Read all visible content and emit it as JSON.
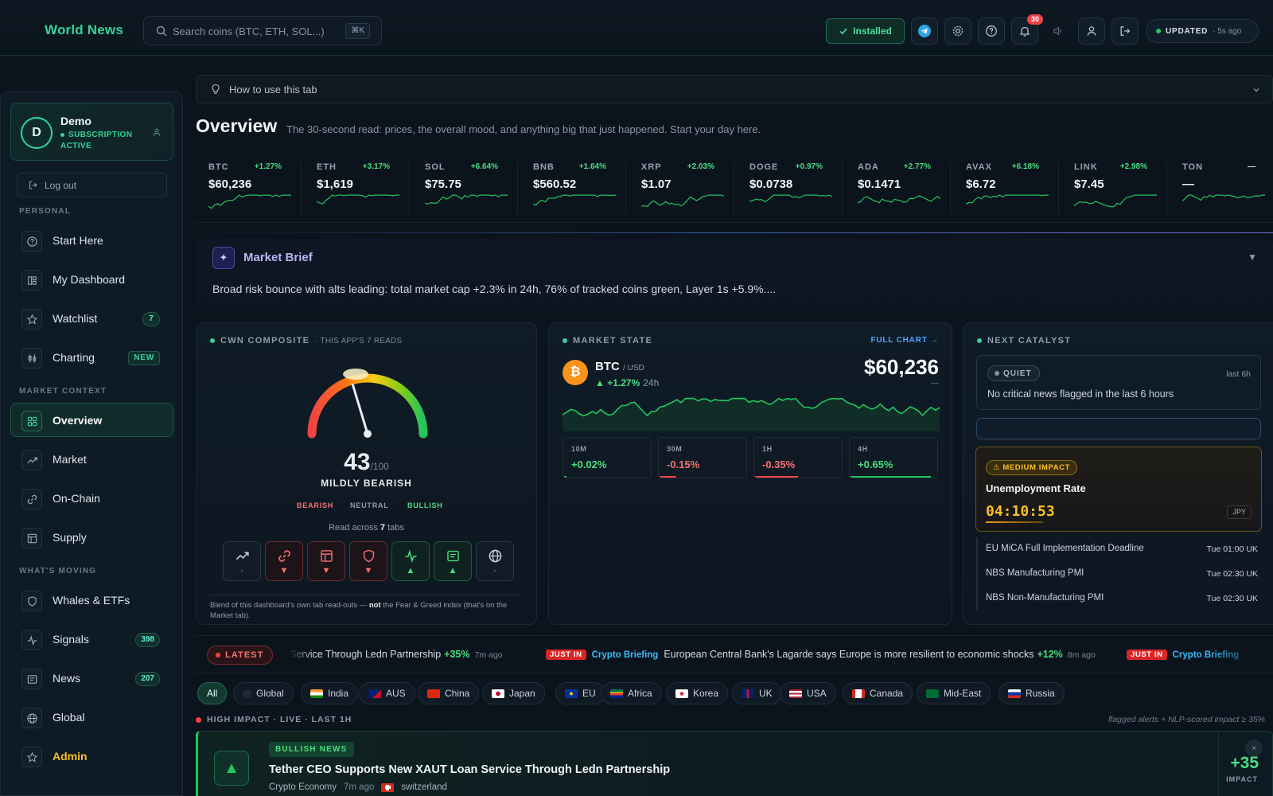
{
  "app": {
    "brand": "World News"
  },
  "search": {
    "placeholder": "Search coins (BTC, ETH, SOL...)",
    "shortcut": "⌘K"
  },
  "toolbar": {
    "installed_label": "Installed",
    "notifications_count": "30",
    "updated_label": "UPDATED",
    "updated_ago": "· 5s ago",
    "icons": [
      "telegram-icon",
      "settings-icon",
      "help-icon",
      "bell-icon",
      "sound-icon",
      "user-icon",
      "logout-icon"
    ]
  },
  "user": {
    "initial": "D",
    "name": "Demo",
    "status": "SUBSCRIPTION ACTIVE"
  },
  "sidebar": {
    "logout_label": "Log out",
    "sections": [
      {
        "label": "PERSONAL",
        "items": [
          {
            "label": "Start Here",
            "icon": "help-circle-icon",
            "badge": ""
          },
          {
            "label": "My Dashboard",
            "icon": "dashboard-icon",
            "badge": ""
          },
          {
            "label": "Watchlist",
            "icon": "star-icon",
            "badge": "7"
          },
          {
            "label": "Charting",
            "icon": "candles-icon",
            "badge": "NEW"
          }
        ]
      },
      {
        "label": "MARKET CONTEXT",
        "items": [
          {
            "label": "Overview",
            "icon": "grid-icon",
            "badge": "",
            "active": true
          },
          {
            "label": "Market",
            "icon": "trend-icon",
            "badge": ""
          },
          {
            "label": "On-Chain",
            "icon": "link-icon",
            "badge": ""
          },
          {
            "label": "Supply",
            "icon": "layout-icon",
            "badge": ""
          }
        ]
      },
      {
        "label": "WHAT'S MOVING",
        "items": [
          {
            "label": "Whales & ETFs",
            "icon": "shield-icon",
            "badge": ""
          },
          {
            "label": "Signals",
            "icon": "pulse-icon",
            "badge": "398"
          },
          {
            "label": "News",
            "icon": "news-icon",
            "badge": "207"
          },
          {
            "label": "Global",
            "icon": "globe-icon",
            "badge": ""
          },
          {
            "label": "Admin",
            "icon": "star-icon",
            "badge": ""
          }
        ]
      }
    ]
  },
  "howto": {
    "label": "How to use this tab"
  },
  "overview": {
    "title": "Overview",
    "subtitle": "The 30-second read: prices, the overall mood, and anything big that just happened. Start your day here."
  },
  "tickers": [
    {
      "sym": "BTC",
      "price": "$60,236",
      "chg": "+1.27%"
    },
    {
      "sym": "ETH",
      "price": "$1,619",
      "chg": "+3.17%"
    },
    {
      "sym": "SOL",
      "price": "$75.75",
      "chg": "+6.64%"
    },
    {
      "sym": "BNB",
      "price": "$560.52",
      "chg": "+1.64%"
    },
    {
      "sym": "XRP",
      "price": "$1.07",
      "chg": "+2.03%"
    },
    {
      "sym": "DOGE",
      "price": "$0.0738",
      "chg": "+0.97%"
    },
    {
      "sym": "ADA",
      "price": "$0.1471",
      "chg": "+2.77%"
    },
    {
      "sym": "AVAX",
      "price": "$6.72",
      "chg": "+6.18%"
    },
    {
      "sym": "LINK",
      "price": "$7.45",
      "chg": "+2.98%"
    },
    {
      "sym": "TON",
      "price": "—",
      "chg": "—"
    }
  ],
  "brief": {
    "title": "Market Brief",
    "text": "Broad risk bounce with alts leading: total market cap +2.3% in 24h, 76% of tracked coins green, Layer 1s +5.9%...."
  },
  "composite": {
    "heading": "CWN COMPOSITE",
    "subheading": "· THIS APP'S 7 READS",
    "score": 43,
    "score_text": "43",
    "score_max": "/100",
    "label": "MILDLY BEARISH",
    "scale": [
      "BEARISH",
      "NEUTRAL",
      "BULLISH"
    ],
    "read_prefix": "Read across",
    "read_count": "7",
    "read_suffix": "tabs",
    "tabs": [
      {
        "icon": "trend-icon",
        "state": "neutral",
        "mark": "·"
      },
      {
        "icon": "link-icon",
        "state": "bearish",
        "mark": "▼"
      },
      {
        "icon": "layout-icon",
        "state": "bearish",
        "mark": "▼"
      },
      {
        "icon": "shield-icon",
        "state": "bearish",
        "mark": "▼"
      },
      {
        "icon": "pulse-icon",
        "state": "bullish",
        "mark": "▲"
      },
      {
        "icon": "news-icon",
        "state": "bullish",
        "mark": "▲"
      },
      {
        "icon": "globe-icon",
        "state": "neutral",
        "mark": "·"
      }
    ],
    "footnote_a": "Blend of this dashboard's own tab read-outs —",
    "footnote_b": "not",
    "footnote_c": "the Fear & Greed index (that's on the Market tab)."
  },
  "market_state": {
    "heading": "MARKET STATE",
    "full_chart": "FULL CHART →",
    "coin": "BTC",
    "pair": "/ USD",
    "change": "▲ +1.27%",
    "period": "24h",
    "price": "$60,236",
    "dash": "—",
    "timeframes": [
      {
        "label": "10M",
        "value": "+0.02%",
        "dir": "up",
        "level": 0.04
      },
      {
        "label": "30M",
        "value": "-0.15%",
        "dir": "down",
        "level": 0.2
      },
      {
        "label": "1H",
        "value": "-0.35%",
        "dir": "down",
        "level": 0.5
      },
      {
        "label": "4H",
        "value": "+0.65%",
        "dir": "up",
        "level": 0.93
      }
    ]
  },
  "catalyst": {
    "heading": "NEXT CATALYST",
    "quiet_label": "QUIET",
    "quiet_window": "last 6h",
    "quiet_text": "No critical news flagged in the last 6 hours",
    "impact_label": "⚠ MEDIUM IMPACT",
    "impact_event": "Unemployment Rate",
    "impact_countdown": "04:10:53",
    "impact_currency": "JPY",
    "events": [
      {
        "name": "EU MiCA Full Implementation Deadline",
        "time": "Tue 01:00 UK"
      },
      {
        "name": "NBS Manufacturing PMI",
        "time": "Tue 02:30 UK"
      },
      {
        "name": "NBS Non-Manufacturing PMI",
        "time": "Tue 02:30 UK"
      }
    ]
  },
  "latest": {
    "label": "LATEST",
    "items": [
      {
        "tag": "",
        "source": "",
        "headline": "Service Through Ledn Partnership",
        "pct": "+35%",
        "ago": "7m ago"
      },
      {
        "tag": "JUST IN",
        "source": "Crypto Briefing",
        "headline": "European Central Bank's Lagarde says Europe is more resilient to economic shocks",
        "pct": "+12%",
        "ago": "8m ago"
      },
      {
        "tag": "JUST IN",
        "source": "Crypto Briefing",
        "headline": "",
        "pct": "",
        "ago": ""
      }
    ]
  },
  "regions": [
    "All",
    "Global",
    "India",
    "AUS",
    "China",
    "Japan",
    "EU",
    "Africa",
    "Korea",
    "UK",
    "USA",
    "Canada",
    "Mid-East",
    "Russia"
  ],
  "high_impact": {
    "label": "HIGH IMPACT · LIVE · LAST 1H",
    "note": "flagged alerts + NLP-scored impact ≥ 35%"
  },
  "news_card": {
    "tag": "BULLISH NEWS",
    "title": "Tether CEO Supports New XAUT Loan Service Through Ledn Partnership",
    "source": "Crypto Economy",
    "ago": "7m ago",
    "country": "switzerland",
    "score": "+35",
    "impact_label": "IMPACT",
    "close": "×"
  },
  "colors": {
    "accent": "#34d399",
    "bull": "#4ade80",
    "bear": "#f87171",
    "warn": "#fbbf24",
    "link": "#4aa8ff"
  }
}
